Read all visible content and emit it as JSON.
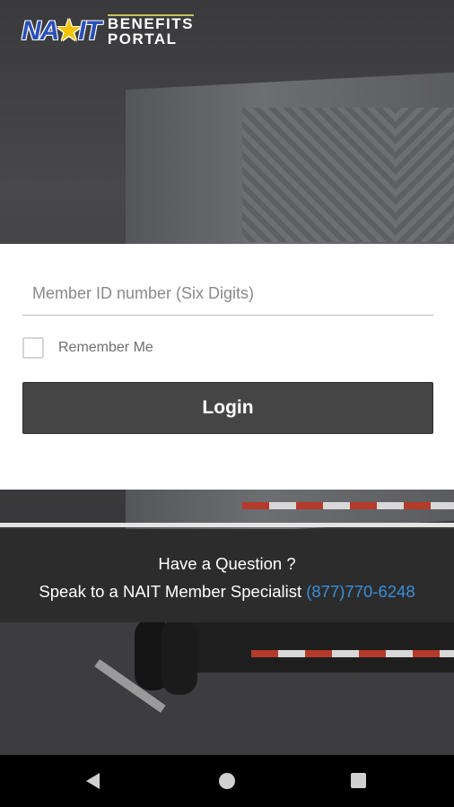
{
  "logo": {
    "mark_left": "NA",
    "mark_star": "★",
    "mark_right": "IT",
    "line1": "BENEFITS",
    "line2": "PORTAL"
  },
  "login_form": {
    "member_id_placeholder": "Member ID number (Six Digits)",
    "member_id_value": "",
    "remember_label": "Remember Me",
    "remember_checked": false,
    "login_label": "Login"
  },
  "help": {
    "question": "Have a Question ?",
    "specialist_text": "Speak to a NAIT Member Specialist",
    "phone": "(877)770-6248",
    "phone_color": "#3a8fd6"
  },
  "navbar": {
    "icons": [
      "back-icon",
      "home-icon",
      "recents-icon"
    ]
  },
  "colors": {
    "button_bg": "#454545",
    "logo_blue": "#2a4fb5",
    "logo_star": "#f2c500"
  }
}
